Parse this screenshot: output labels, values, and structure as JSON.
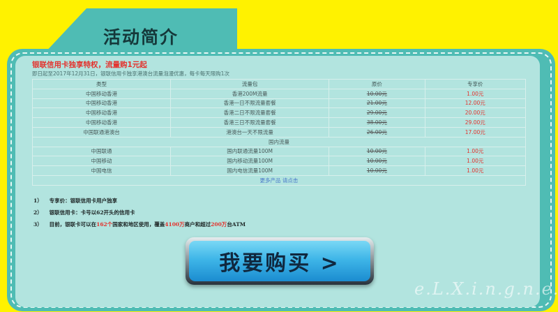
{
  "header": {
    "title": "活动简介"
  },
  "promo": {
    "headline": "银联信用卡独享特权，流量购1元起",
    "subline": "即日起至2017年12月31日，银联信用卡独享港澳台流量泡漫优惠，每卡每天限购1次"
  },
  "table": {
    "columns": [
      "类型",
      "流量包",
      "原价",
      "专享价"
    ],
    "rows": [
      [
        "中国移动香港",
        "香港200M流量",
        "10.00元",
        "1.00元"
      ],
      [
        "中国移动香港",
        "香港一日不限流量套餐",
        "21.00元",
        "12.00元"
      ],
      [
        "中国移动香港",
        "香港二日不限流量套餐",
        "29.00元",
        "20.00元"
      ],
      [
        "中国移动香港",
        "香港三日不限流量套餐",
        "38.00元",
        "29.00元"
      ],
      [
        "中国联通港澳台",
        "港澳台一天不限流量",
        "26.00元",
        "17.00元"
      ]
    ],
    "domestic_label": "国内流量",
    "domestic_rows": [
      [
        "中国联通",
        "国内联通流量100M",
        "10.00元",
        "1.00元"
      ],
      [
        "中国移动",
        "国内移动流量100M",
        "10.00元",
        "1.00元"
      ],
      [
        "中国电信",
        "国内电信流量100M",
        "10.00元",
        "1.00元"
      ]
    ],
    "more_link": "更多产品 请点击"
  },
  "notes": {
    "n1": {
      "num": "1）",
      "text": "专享价：银联信用卡用户独享"
    },
    "n2": {
      "num": "2）",
      "text": "银联信用卡：卡号以62开头的信用卡"
    },
    "n3": {
      "num": "3）",
      "a": "目前，银联卡可以在",
      "b": "162个",
      "c": "国家和地区使用，覆盖",
      "d": "4100万",
      "e": "商户和超过",
      "f": "200万",
      "g": "台ATM"
    }
  },
  "buy_button": {
    "label": "我要购买 >"
  },
  "watermark": "e.L.X.i.n.g.n.e.t",
  "colors": {
    "background": "#fff200",
    "panel": "#4fbcb4",
    "inner": "#b2e4df",
    "highlight": "#e4322d",
    "button": "#3fb6e8"
  }
}
